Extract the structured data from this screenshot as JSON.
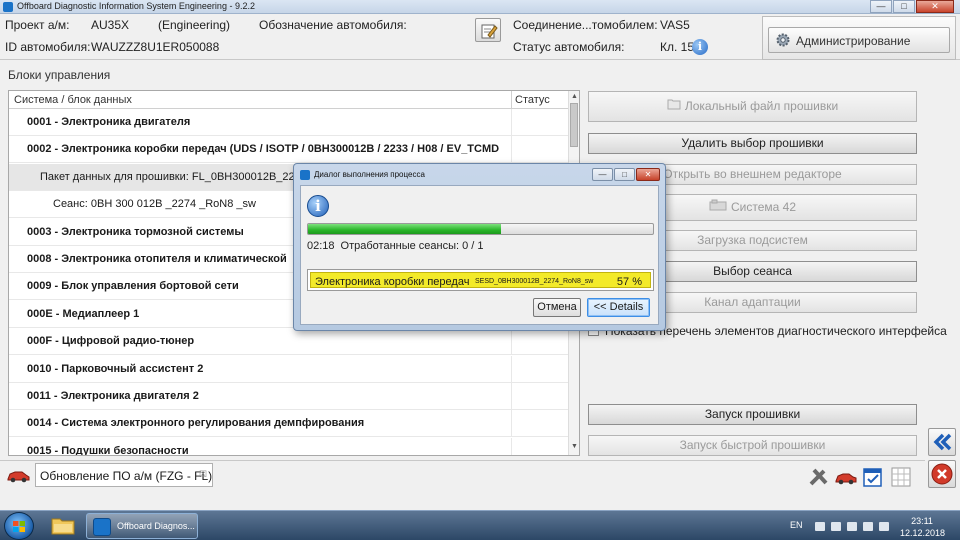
{
  "window": {
    "title": "Offboard Diagnostic Information System Engineering - 9.2.2",
    "buttons": [
      "—",
      "□",
      "✕"
    ]
  },
  "header": {
    "project_label": "Проект а/м:",
    "project_value": "AU35X",
    "project_mode": "(Engineering)",
    "vehicle_designation_label": "Обозначение автомобиля:",
    "vehicle_id_label": "ID автомобиля:",
    "vehicle_id_value": "WAUZZZ8U1ER050088",
    "connection_label": "Соединение...томобилем:",
    "connection_value": "VAS5",
    "status_label": "Статус автомобиля:",
    "status_value": "Кл. 15",
    "admin_button": "Администрирование"
  },
  "left_panel": {
    "title": "Блоки управления",
    "col_system": "Система / блок данных",
    "col_status": "Статус",
    "rows": [
      {
        "text": "0001 - Электроника двигателя",
        "bold": true,
        "indent": 0
      },
      {
        "text": "0002 - Электроника коробки передач  (UDS / ISOTP / 0BH300012B / 2233 / H08 / EV_TCMD",
        "bold": true,
        "indent": 0
      },
      {
        "text": "Пакет данных для прошивки: FL_0BH300012B_22",
        "bold": false,
        "indent": 1,
        "selected": true
      },
      {
        "text": "Сеанс: 0BH 300 012B _2274 _RoN8 _sw",
        "bold": false,
        "indent": 2
      },
      {
        "text": "0003 - Электроника тормозной системы",
        "bold": true,
        "indent": 0
      },
      {
        "text": "0008 - Электроника отопителя и климатической",
        "bold": true,
        "indent": 0
      },
      {
        "text": "0009 - Блок управления бортовой сети",
        "bold": true,
        "indent": 0
      },
      {
        "text": "000E - Медиаплеер 1",
        "bold": true,
        "indent": 0
      },
      {
        "text": "000F - Цифровой радио-тюнер",
        "bold": true,
        "indent": 0
      },
      {
        "text": "0010 - Парковочный ассистент 2",
        "bold": true,
        "indent": 0
      },
      {
        "text": "0011 - Электроника двигателя 2",
        "bold": true,
        "indent": 0
      },
      {
        "text": "0014 - Система электронного регулирования демпфирования",
        "bold": true,
        "indent": 0
      },
      {
        "text": "0015 - Подушки безопасности",
        "bold": true,
        "indent": 0
      }
    ]
  },
  "right_panel": {
    "local_file": "Локальный файл прошивки",
    "delete_selection": "Удалить выбор прошивки",
    "open_external": "Открыть во внешнем редакторе",
    "system42": "Система 42",
    "load_subsystems": "Загрузка подсистем",
    "select_session": "Выбор сеанса",
    "adaptation_channel": "Канал адаптации",
    "show_list_checkbox": "Показать перечень элементов диагностического интерфейса",
    "start_flash": "Запуск прошивки",
    "start_quick_flash": "Запуск быстрой прошивки"
  },
  "dialog": {
    "title": "Диалог выполнения процесса",
    "progress": 0.56,
    "time": "02:18",
    "sessions_text": "Отработанные сеансы: 0 / 1",
    "item_name": "Электроника коробки передач",
    "item_session": "SESD_0BH300012B_2274_RoN8_sw",
    "item_percent": "57 %",
    "cancel_button": "Отмена",
    "details_button": "<< Details"
  },
  "bottom": {
    "tab_label": "Обновление ПО а/м (FZG - FL)",
    "tab_close": "☒"
  },
  "taskbar": {
    "app_label": "Offboard Diagnos...",
    "lang": "EN",
    "time": "23:11",
    "date": "12.12.2018"
  },
  "colors": {
    "progress": "#2ab52a",
    "highlight": "#f3ea2a",
    "accent": "#1a73c8"
  }
}
